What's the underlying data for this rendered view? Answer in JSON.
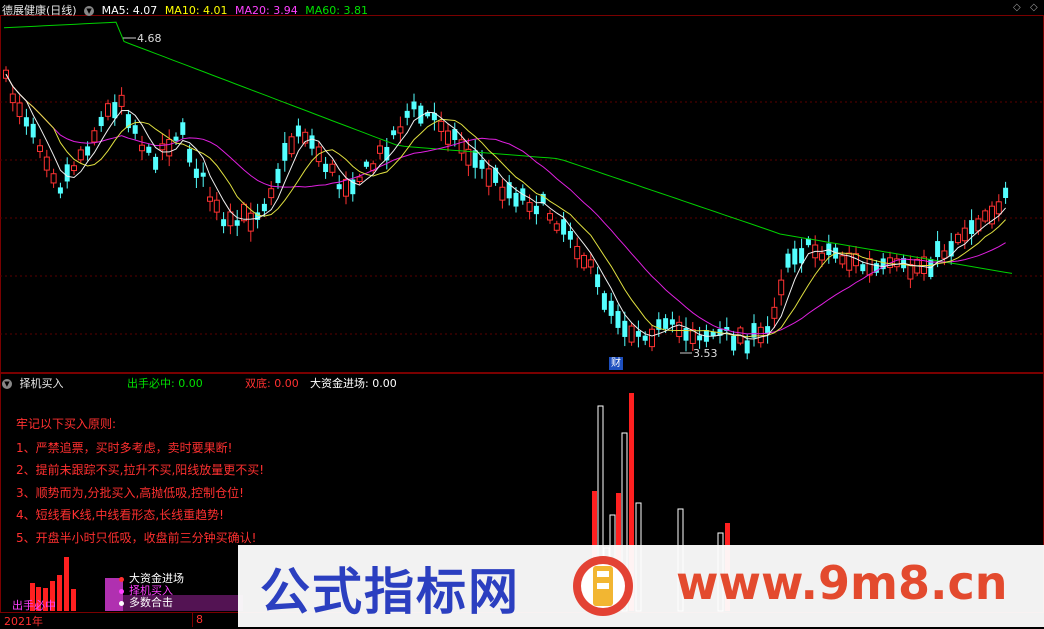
{
  "header": {
    "stock_title": "德展健康(日线)",
    "ma5": "MA5: 4.07",
    "ma10": "MA10: 4.01",
    "ma20": "MA20: 3.94",
    "ma60": "MA60: 3.81"
  },
  "main_chart": {
    "high_label": "4.68",
    "low_label": "3.53",
    "event_marker": "财"
  },
  "indicator": {
    "name": "择机买入",
    "v1": "出手必中: 0.00",
    "v2": "双底: 0.00",
    "v3": "大资金进场: 0.00",
    "rules": [
      "牢记以下买入原则:",
      "1、严禁追票，买时多考虑，卖时要果断!",
      "2、提前未跟踪不买,拉升不买,阳线放量更不买!",
      "3、顺势而为,分批买入,高抛低吸,控制仓位!",
      "4、短线看K线,中线看形态,长线重趋势!",
      "5、开盘半小时只低吸，收盘前三分钟买确认!"
    ],
    "legend": [
      "大资金进场",
      "择机买入",
      "多数合击"
    ],
    "left_overlay": "出手必中"
  },
  "axis": {
    "year": "2021年",
    "month": "8"
  },
  "watermark": {
    "text1": "公式指标网",
    "text2": "www.9m8.cn"
  },
  "colors": {
    "up": "#ff3232",
    "down": "#54ffff",
    "ma5": "#ffffff",
    "ma10": "#ffff00",
    "ma20": "#ff00ff",
    "ma60": "#00e000",
    "accent_red": "#ff2020"
  },
  "icons": {
    "dropdown": "triangle-down-icon",
    "diamond": "diamond-icon",
    "expand": "expand-icon"
  }
}
